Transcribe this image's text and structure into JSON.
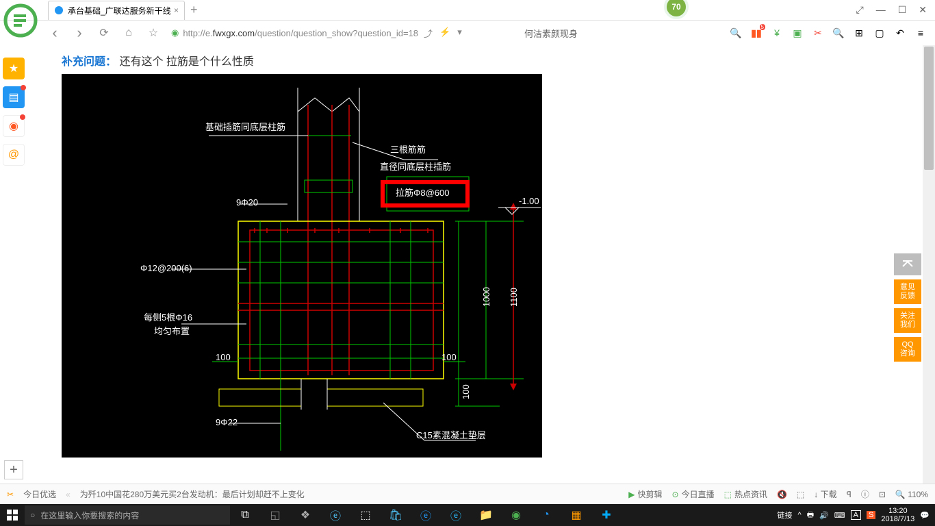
{
  "tab": {
    "title": "承台基础_广联达服务新干线",
    "close": "×",
    "newtab": "+"
  },
  "badge": "70",
  "win": {
    "pin": "⤢",
    "min": "—",
    "max": "☐",
    "close": "✕"
  },
  "nav": {
    "back": "‹",
    "fwd": "›",
    "reload": "⟳",
    "home": "⌂",
    "star": "☆"
  },
  "url": {
    "prefix": "http://e.",
    "domain": "fwxgx.com",
    "path": "/question/question_show?question_id=18"
  },
  "search_hint": "何洁素颜现身",
  "question": {
    "label": "补充问题：",
    "text": "还有这个 拉筋是个什么性质"
  },
  "cad": {
    "t1": "基础插筋同底层柱筋",
    "t2": "三根筋筋",
    "t3": "直径同底层柱插筋",
    "t4": "拉筋Φ8@600",
    "t5": "9Φ20",
    "t6": "Φ12@200(6)",
    "t7": "每侧5根Φ16",
    "t8": "均匀布置",
    "t9": "100",
    "t10": "100",
    "t11": "9Φ22",
    "t12": "C15素混凝土垫层",
    "t13": "-1.00",
    "t14": "1100",
    "t15": "1000",
    "t16": "100"
  },
  "rside": {
    "top": "⌃",
    "b1": "意见\n反馈",
    "b2": "关注\n我们",
    "b3": "QQ\n咨询"
  },
  "infobar": {
    "today": "今日优选",
    "news": "为歼10中国花280万美元买2台发动机：最后计划却赶不上变化",
    "r1": "快剪辑",
    "r2": "今日直播",
    "r3": "热点资讯",
    "r4": "↓ 下载",
    "r5": "ꟼ",
    "r6": "ⓘ",
    "r7": "⊡",
    "zoom": "🔍 110%"
  },
  "taskbar": {
    "search_ph": "在这里输入你要搜索的内容",
    "tray_text": "链接",
    "time": "13:20",
    "date": "2018/7/13"
  }
}
